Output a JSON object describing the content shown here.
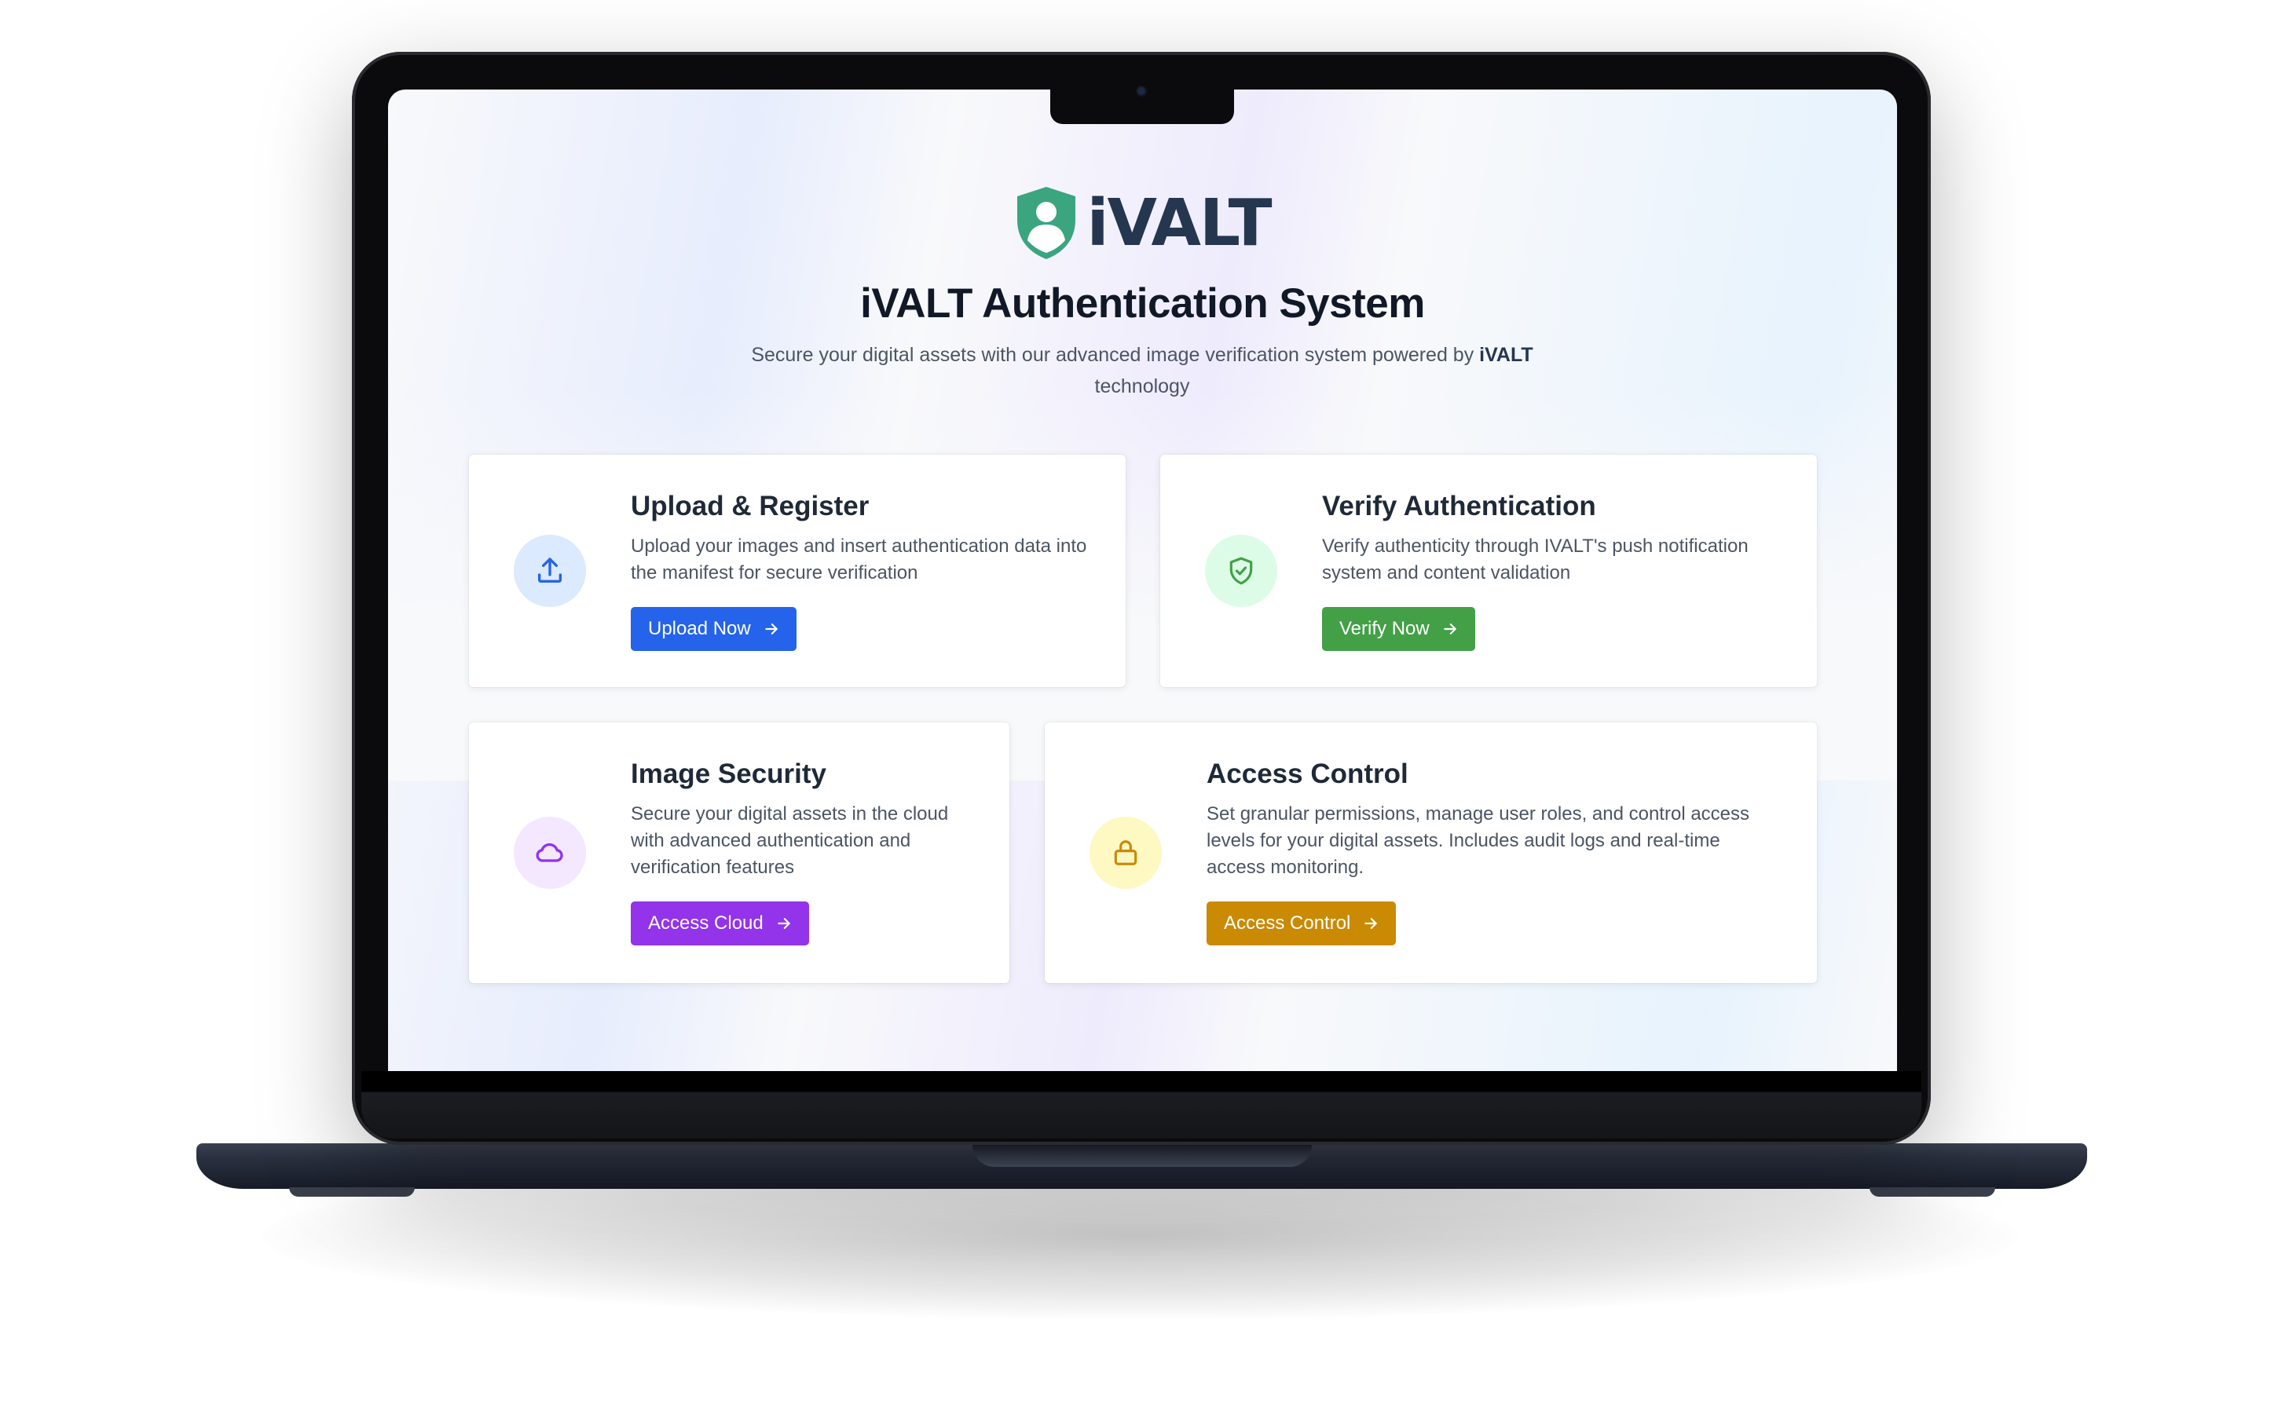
{
  "brand": {
    "name": "iVALT",
    "logo_icon": "shield-user-icon",
    "logo_color": "#3aa57f"
  },
  "hero": {
    "title": "iVALT Authentication System",
    "subtitle_pre": "Secure your digital assets with our advanced image verification system powered by",
    "subtitle_highlight": "iVALT",
    "subtitle_post": "technology"
  },
  "cards": [
    {
      "title": "Upload & Register",
      "description": "Upload your images and insert authentication data into the manifest for secure verification",
      "button_label": "Upload Now",
      "icon": "upload-icon",
      "accent": "#2563eb",
      "icon_bg": "#dbeafe"
    },
    {
      "title": "Verify Authentication",
      "description": "Verify authenticity through IVALT's push notification system and content validation",
      "button_label": "Verify Now",
      "icon": "shield-check-icon",
      "accent": "#43a047",
      "icon_bg": "#dcfce7"
    },
    {
      "title": "Image Security",
      "description": "Secure your digital assets in the cloud with advanced authentication and verification features",
      "button_label": "Access Cloud",
      "icon": "cloud-icon",
      "accent": "#9333ea",
      "icon_bg": "#f3e8ff"
    },
    {
      "title": "Access Control",
      "description": "Set granular permissions, manage user roles, and control access levels for your digital assets. Includes audit logs and real-time access monitoring.",
      "button_label": "Access Control",
      "icon": "lock-icon",
      "accent": "#ca8a04",
      "icon_bg": "#fef9c3"
    }
  ]
}
